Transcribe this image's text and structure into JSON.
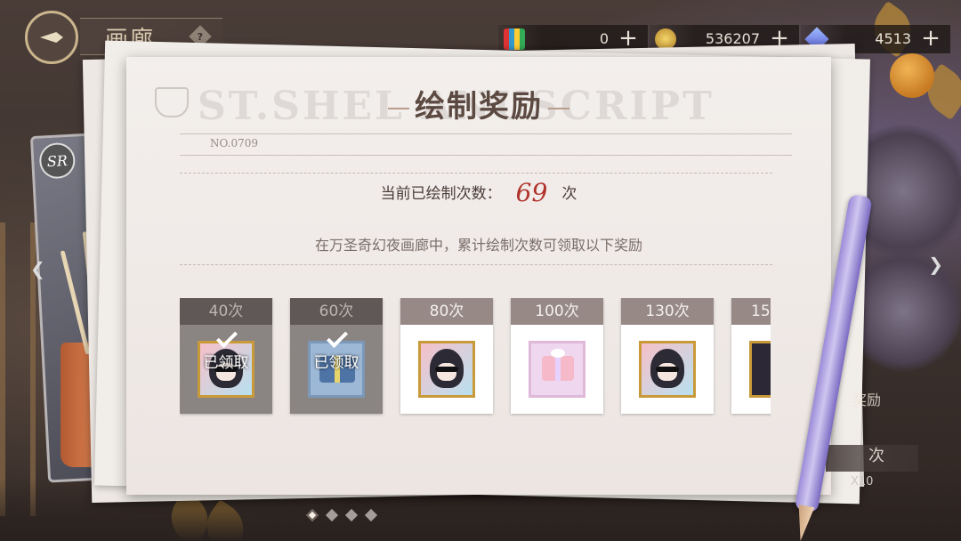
{
  "header": {
    "title": "画廊",
    "help_symbol": "?"
  },
  "resources": [
    {
      "icon": "paint-palette-icon",
      "value": "0",
      "plus": "+"
    },
    {
      "icon": "coin-icon",
      "value": "536207",
      "plus": "+"
    },
    {
      "icon": "gem-icon",
      "value": "4513",
      "plus": "+"
    }
  ],
  "panel": {
    "title": "绘制奖励",
    "watermark": "ST.SHEL    ANUSCRIPT",
    "serial": "NO.0709",
    "count_label": "当前已绘制次数：",
    "count_value": "69",
    "count_unit": "次",
    "description": "在万圣奇幻夜画廊中，累计绘制次数可领取以下奖励"
  },
  "rewards": [
    {
      "label": "40次",
      "status": "claimed",
      "status_text": "已领取",
      "item": "avatar-frame"
    },
    {
      "label": "60次",
      "status": "claimed",
      "status_text": "已领取",
      "item": "gift-box-blue"
    },
    {
      "label": "80次",
      "status": "locked",
      "status_text": "",
      "item": "avatar-frame"
    },
    {
      "label": "100次",
      "status": "locked",
      "status_text": "",
      "item": "gift-box-pink"
    },
    {
      "label": "130次",
      "status": "locked",
      "status_text": "",
      "item": "avatar-frame"
    },
    {
      "label": "15",
      "status": "locked",
      "status_text": "",
      "item": "card-partial"
    }
  ],
  "side": {
    "draw_button": "次",
    "multiplier": "X10",
    "hint": "奖励"
  },
  "card": {
    "rarity": "SR"
  },
  "pagination": {
    "pages": 4,
    "active": 1
  }
}
